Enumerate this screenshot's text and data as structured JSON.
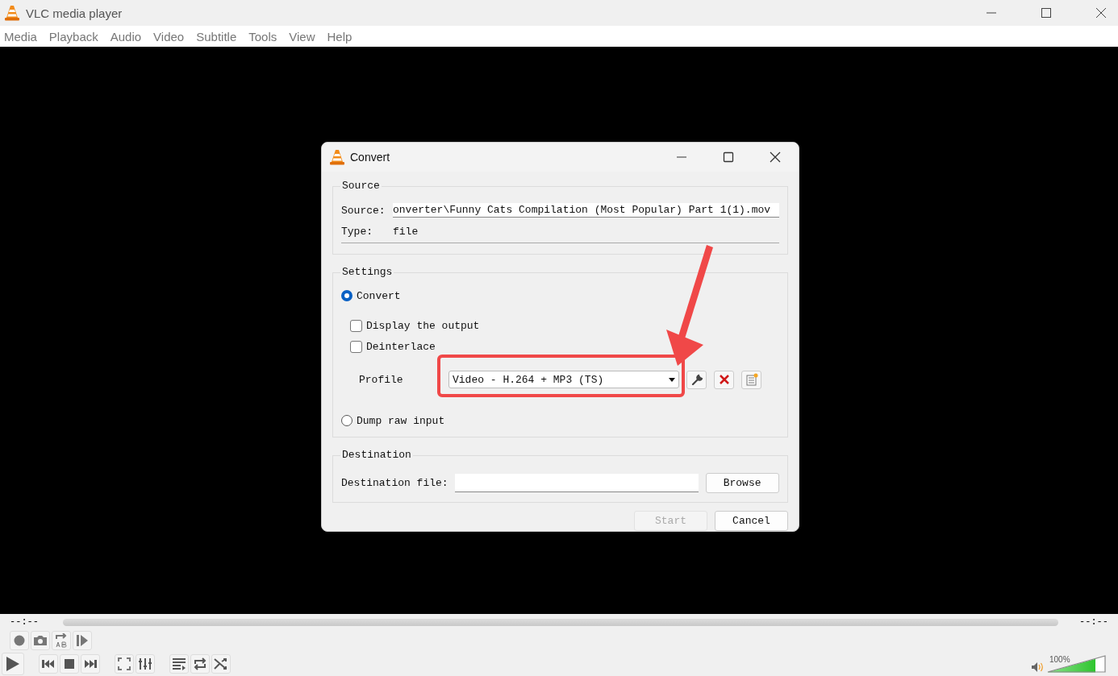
{
  "window": {
    "title": "VLC media player"
  },
  "menu": [
    "Media",
    "Playback",
    "Audio",
    "Video",
    "Subtitle",
    "Tools",
    "View",
    "Help"
  ],
  "dialog": {
    "title": "Convert",
    "source": {
      "legend": "Source",
      "source_label": "Source:",
      "source_value": "onverter\\Funny Cats Compilation (Most Popular) Part 1(1).mov",
      "type_label": "Type:",
      "type_value": "file"
    },
    "settings": {
      "legend": "Settings",
      "modes": [
        {
          "label": "Convert",
          "selected": true
        },
        {
          "label": "Dump raw input",
          "selected": false
        }
      ],
      "options": [
        {
          "label": "Display the output",
          "checked": false
        },
        {
          "label": "Deinterlace",
          "checked": false
        }
      ],
      "profile_label": "Profile",
      "profile_value": "Video - H.264 + MP3 (TS)"
    },
    "destination": {
      "legend": "Destination",
      "file_label": "Destination file:",
      "browse": "Browse"
    },
    "buttons": [
      {
        "label": "Start",
        "disabled": true
      },
      {
        "label": "Cancel",
        "disabled": false
      }
    ]
  },
  "player": {
    "elapsed": "--:--",
    "remaining": "--:--",
    "volume": {
      "reading": "100%",
      "level": 0.83
    }
  }
}
